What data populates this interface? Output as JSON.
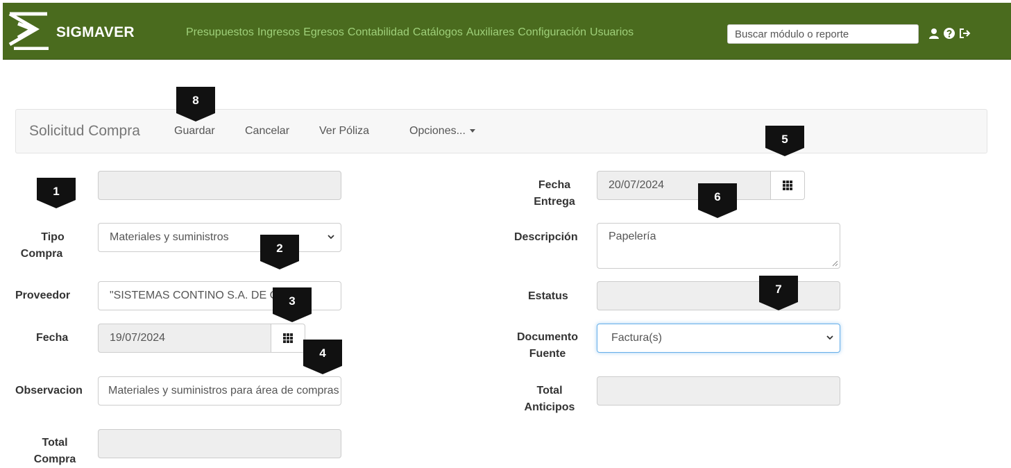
{
  "app": {
    "brand": "SIGMAVER",
    "nav": [
      "Presupuestos",
      "Ingresos",
      "Egresos",
      "Contabilidad",
      "Catálogos",
      "Auxiliares",
      "Configuración",
      "Usuarios"
    ],
    "search_placeholder": "Buscar módulo o reporte",
    "colors": {
      "topbar": "#4a6b1e",
      "nav_link": "#9fd07a"
    },
    "icons": [
      "user-icon",
      "help-icon",
      "logout-icon"
    ]
  },
  "toolbar": {
    "title": "Solicitud Compra",
    "save": "Guardar",
    "cancel": "Cancelar",
    "view_policy": "Ver Póliza",
    "options": "Opciones..."
  },
  "form": {
    "id_value": "",
    "tipo_compra_label_1": "Tipo",
    "tipo_compra_label_2": "Compra",
    "tipo_compra_value": "Materiales y suministros",
    "proveedor_label": "Proveedor",
    "proveedor_value": "\"SISTEMAS CONTINO S.A. DE C.V.\"",
    "fecha_label": "Fecha",
    "fecha_value": "19/07/2024",
    "observacion_label": "Observacion",
    "observacion_value": "Materiales y suministros para área de compras",
    "total_compra_label_1": "Total",
    "total_compra_label_2": "Compra",
    "total_compra_value": "",
    "fecha_entrega_label_1": "Fecha",
    "fecha_entrega_label_2": "Entrega",
    "fecha_entrega_value": "20/07/2024",
    "descripcion_label": "Descripción",
    "descripcion_value": "Papelería",
    "estatus_label": "Estatus",
    "estatus_value": "",
    "documento_fuente_label_1": "Documento",
    "documento_fuente_label_2": "Fuente",
    "documento_fuente_value": "Factura(s)",
    "total_anticipos_label_1": "Total",
    "total_anticipos_label_2": "Anticipos",
    "total_anticipos_value": ""
  },
  "callouts": {
    "c1": "1",
    "c2": "2",
    "c3": "3",
    "c4": "4",
    "c5": "5",
    "c6": "6",
    "c7": "7",
    "c8": "8"
  }
}
